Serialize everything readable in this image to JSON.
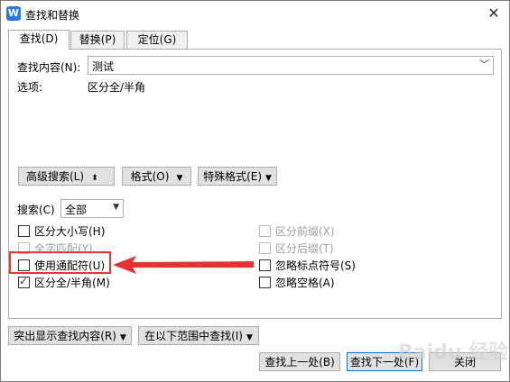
{
  "window": {
    "title": "查找和替换",
    "app_icon_letter": "W"
  },
  "tabs": [
    {
      "label": "查找(D)",
      "active": true
    },
    {
      "label": "替换(P)",
      "active": false
    },
    {
      "label": "定位(G)",
      "active": false
    }
  ],
  "find": {
    "label": "查找内容(N):",
    "value": "测试",
    "options_label": "选项:",
    "options_value": "区分全/半角"
  },
  "buttons": {
    "advanced": "高级搜索(L)",
    "format": "格式(O)",
    "special": "特殊格式(E)",
    "highlight": "突出显示查找内容(R)",
    "find_in": "在以下范围中查找(I)",
    "find_prev": "查找上一处(B)",
    "find_next": "查找下一处(F)",
    "close": "关闭"
  },
  "search": {
    "label": "搜索(C)",
    "value": "全部"
  },
  "checkboxes_left": [
    {
      "label": "区分大小写(H)",
      "checked": false,
      "disabled": false
    },
    {
      "label": "全字匹配(Y)",
      "checked": false,
      "disabled": true
    },
    {
      "label": "使用通配符(U)",
      "checked": false,
      "disabled": false
    },
    {
      "label": "区分全/半角(M)",
      "checked": true,
      "disabled": false
    }
  ],
  "checkboxes_right": [
    {
      "label": "区分前缀(X)",
      "checked": false,
      "disabled": true
    },
    {
      "label": "区分后缀(T)",
      "checked": false,
      "disabled": true
    },
    {
      "label": "忽略标点符号(S)",
      "checked": false,
      "disabled": false
    },
    {
      "label": "忽略空格(A)",
      "checked": false,
      "disabled": false
    }
  ],
  "annotation_color": "#e33333",
  "watermark": "Baidu 经验"
}
